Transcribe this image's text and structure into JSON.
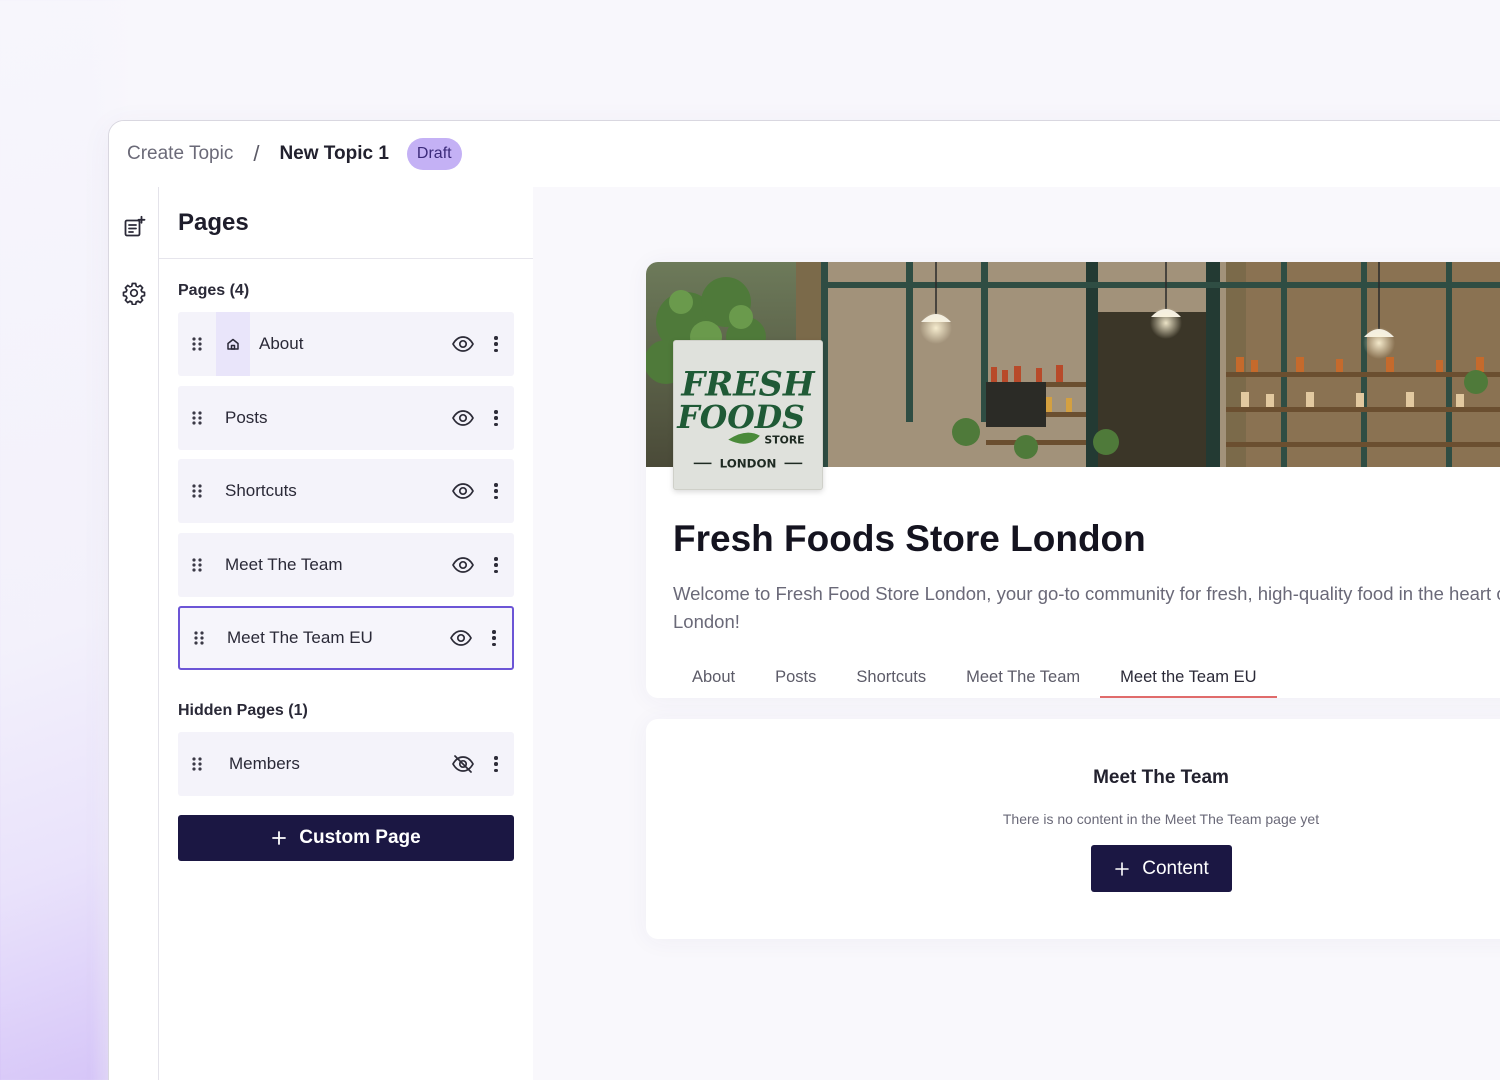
{
  "breadcrumb": {
    "root": "Create Topic",
    "separator": "/",
    "current": "New Topic 1",
    "status": "Draft"
  },
  "rail": {
    "icons": [
      "add-page-icon",
      "settings-gear-icon"
    ]
  },
  "panel": {
    "title": "Pages",
    "pages_section": "Pages (4)",
    "pages": [
      {
        "label": "About",
        "home": true,
        "visible": true
      },
      {
        "label": "Posts",
        "visible": true
      },
      {
        "label": "Shortcuts",
        "visible": true
      },
      {
        "label": "Meet The Team",
        "visible": true
      },
      {
        "label": "Meet The Team EU",
        "visible": true,
        "selected": true
      }
    ],
    "hidden_section": "Hidden Pages (1)",
    "hidden_pages": [
      {
        "label": "Members",
        "visible": false
      }
    ],
    "custom_page_button": "Custom Page"
  },
  "preview": {
    "logo_text": "FRESH FOODS STORE LONDON",
    "title": "Fresh Foods Store London",
    "description": "Welcome to Fresh Food Store London, your go-to community for fresh, high-quality food in the heart of London!",
    "tabs": [
      "About",
      "Posts",
      "Shortcuts",
      "Meet The Team",
      "Meet the Team EU"
    ],
    "active_tab": "Meet the Team EU",
    "empty_title": "Meet The Team",
    "empty_text": "There is no content in the Meet The Team page yet",
    "content_button": "Content"
  },
  "colors": {
    "accent": "#1b1743",
    "draft_badge": "#c4b1f5",
    "selected_border": "#6c55d6",
    "active_tab_underline": "#e06b6b"
  }
}
